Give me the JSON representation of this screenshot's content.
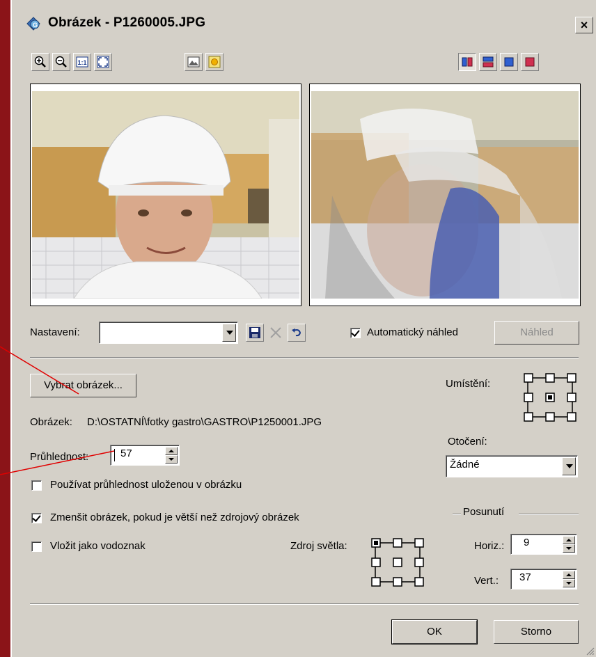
{
  "window": {
    "title": "Obrázek - P1260005.JPG",
    "close": "×"
  },
  "toolbar": {
    "left": [
      "zoom-in-icon",
      "zoom-out-icon",
      "actual-size-icon",
      "fit-window-icon",
      "landscape-icon",
      "sun-icon"
    ],
    "right": [
      "split-vertical-icon",
      "split-horizontal-icon",
      "blue-square-icon",
      "red-square-icon"
    ]
  },
  "settings": {
    "label": "Nastavení:",
    "value": "",
    "auto_preview": "Automatický náhled",
    "auto_preview_checked": true,
    "preview_button": "Náhled"
  },
  "select_image": {
    "button": "Vybrat obrázek..."
  },
  "image_path": {
    "label": "Obrázek:",
    "value": "D:\\OSTATNÍ\\fotky gastro\\GASTRO\\P1250001.JPG"
  },
  "opacity": {
    "label": "Průhlednost:",
    "value": "57"
  },
  "options": {
    "use_stored_opacity": "Používat průhlednost uloženou v obrázku",
    "use_stored_opacity_checked": false,
    "shrink": "Zmenšit obrázek, pokud je větší než zdrojový obrázek",
    "shrink_checked": true,
    "watermark": "Vložit jako vodoznak",
    "watermark_checked": false
  },
  "placement": {
    "label": "Umístění:",
    "selected": 4
  },
  "rotation": {
    "label": "Otočení:",
    "value": "Žádné"
  },
  "offset": {
    "legend": "Posunutí",
    "horiz_label": "Horiz.:",
    "horiz_value": "9",
    "vert_label": "Vert.:",
    "vert_value": "37"
  },
  "light_source": {
    "label": "Zdroj světla:",
    "selected": 0
  },
  "buttons": {
    "ok": "OK",
    "cancel": "Storno"
  },
  "colors": {
    "background": "#8b1418",
    "dialog": "#d4d0c8",
    "annotation": "#e00000"
  }
}
